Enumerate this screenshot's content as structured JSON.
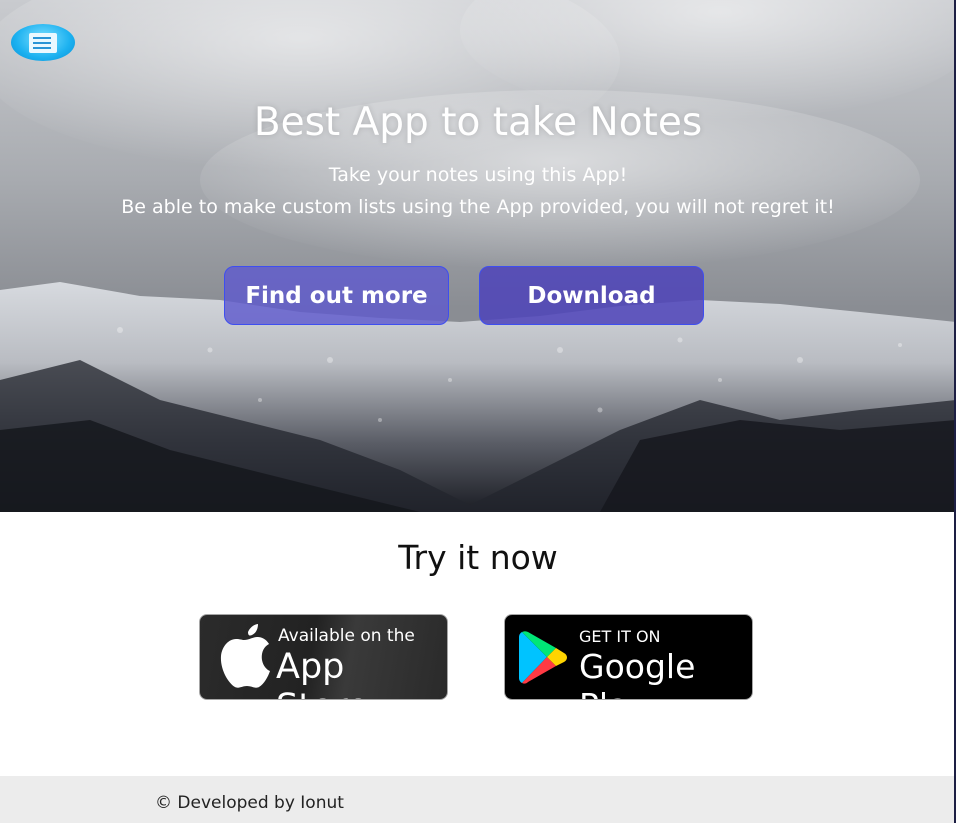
{
  "hero": {
    "title": "Best App to take Notes",
    "subtitle_line1": "Take your notes using this App!",
    "subtitle_line2": "Be able to make custom lists using the App provided, you will not regret it!",
    "buttons": [
      {
        "label": "Find out more"
      },
      {
        "label": "Download"
      }
    ],
    "logo_icon": "notes-icon"
  },
  "try_section": {
    "title": "Try it now",
    "app_store": {
      "line1": "Available on the",
      "line2": "App Store",
      "icon": "apple-icon"
    },
    "google_play": {
      "line1": "GET IT ON",
      "line2": "Google Play",
      "icon": "play-icon"
    }
  },
  "footer": {
    "text": "© Developed by Ionut"
  },
  "colors": {
    "button_fill": "#5f5acd",
    "button_border": "#3e4ef0",
    "footer_bg": "#ececec",
    "logo": "#1cb1f0"
  }
}
